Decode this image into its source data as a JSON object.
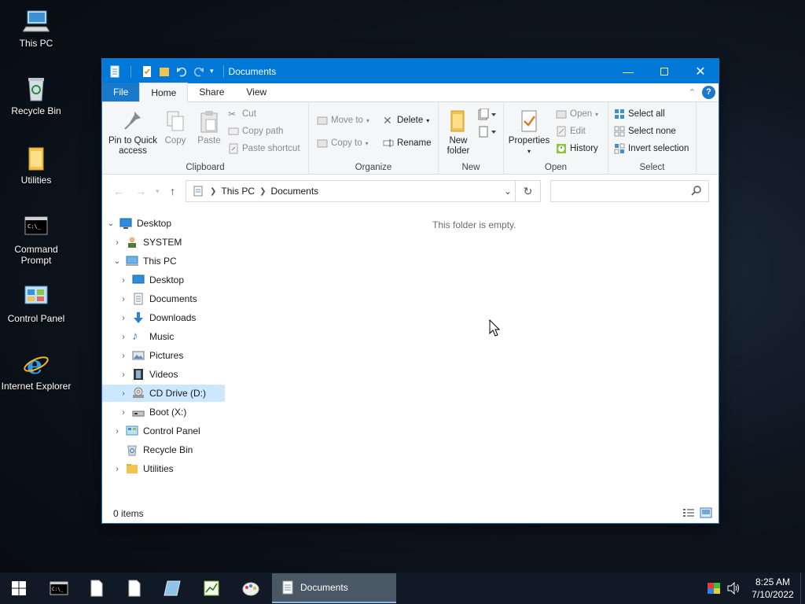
{
  "desktop": {
    "icons": [
      {
        "label": "This PC"
      },
      {
        "label": "Recycle Bin"
      },
      {
        "label": "Utilities"
      },
      {
        "label": "Command Prompt"
      },
      {
        "label": "Control Panel"
      },
      {
        "label": "Internet Explorer"
      }
    ]
  },
  "window": {
    "title": "Documents",
    "tabs": {
      "file": "File",
      "home": "Home",
      "share": "Share",
      "view": "View"
    },
    "ribbon": {
      "clipboard": {
        "pin": "Pin to Quick access",
        "copy": "Copy",
        "paste": "Paste",
        "cut": "Cut",
        "copy_path": "Copy path",
        "paste_shortcut": "Paste shortcut",
        "label": "Clipboard"
      },
      "organize": {
        "move_to": "Move to",
        "copy_to": "Copy to",
        "delete": "Delete",
        "rename": "Rename",
        "label": "Organize"
      },
      "new": {
        "new_folder": "New folder",
        "label": "New"
      },
      "open": {
        "properties": "Properties",
        "open": "Open",
        "edit": "Edit",
        "history": "History",
        "label": "Open"
      },
      "select": {
        "select_all": "Select all",
        "select_none": "Select none",
        "invert": "Invert selection",
        "label": "Select"
      }
    },
    "address": {
      "crumbs": [
        "This PC",
        "Documents"
      ],
      "search_placeholder": ""
    },
    "tree": {
      "desktop": "Desktop",
      "system": "SYSTEM",
      "this_pc": "This PC",
      "pc_desktop": "Desktop",
      "documents": "Documents",
      "downloads": "Downloads",
      "music": "Music",
      "pictures": "Pictures",
      "videos": "Videos",
      "cd_drive": "CD Drive (D:)",
      "boot": "Boot (X:)",
      "control_panel": "Control Panel",
      "recycle_bin": "Recycle Bin",
      "utilities": "Utilities"
    },
    "empty_message": "This folder is empty.",
    "status": "0 items"
  },
  "taskbar": {
    "active_window": "Documents",
    "time": "8:25 AM",
    "date": "7/10/2022"
  },
  "colors": {
    "titlebar": "#0078d7",
    "selection": "#cce8ff",
    "taskbar": "#101925"
  }
}
